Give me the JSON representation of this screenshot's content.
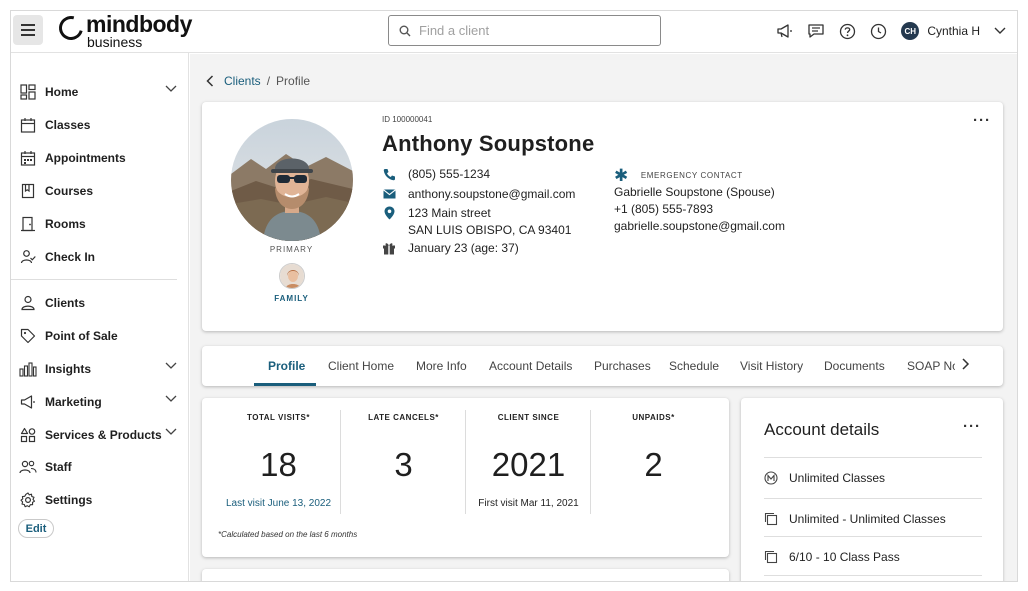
{
  "brand": {
    "name": "mindbody",
    "sub": "business"
  },
  "search": {
    "placeholder": "Find a client"
  },
  "user": {
    "initials": "CH",
    "name": "Cynthia H"
  },
  "sidebar": {
    "items": [
      {
        "label": "Home",
        "icon": "home-grid-icon"
      },
      {
        "label": "Classes",
        "icon": "calendar-icon"
      },
      {
        "label": "Appointments",
        "icon": "calendar-grid-icon"
      },
      {
        "label": "Courses",
        "icon": "bookmark-icon"
      },
      {
        "label": "Rooms",
        "icon": "door-icon"
      },
      {
        "label": "Check In",
        "icon": "person-check-icon"
      },
      {
        "label": "Clients",
        "icon": "person-icon"
      },
      {
        "label": "Point of Sale",
        "icon": "tag-icon"
      },
      {
        "label": "Insights",
        "icon": "bar-chart-icon"
      },
      {
        "label": "Marketing",
        "icon": "megaphone-icon"
      },
      {
        "label": "Services & Products",
        "icon": "shapes-icon"
      },
      {
        "label": "Staff",
        "icon": "people-icon"
      },
      {
        "label": "Settings",
        "icon": "gear-icon"
      }
    ],
    "edit_label": "Edit"
  },
  "breadcrumb": {
    "parent": "Clients",
    "separator": "/",
    "current": "Profile"
  },
  "profile": {
    "id": "ID 100000041",
    "name": "Anthony Soupstone",
    "phone": "(805) 555-1234",
    "email": "anthony.soupstone@gmail.com",
    "address_line1": "123 Main street",
    "address_line2": "SAN LUIS OBISPO, CA 93401",
    "birthday": "January 23 (age: 37)",
    "primary_label": "PRIMARY",
    "family_label": "FAMILY",
    "emergency": {
      "heading": "EMERGENCY CONTACT",
      "name": "Gabrielle Soupstone (Spouse)",
      "phone": "+1 (805) 555-7893",
      "email": "gabrielle.soupstone@gmail.com"
    }
  },
  "tabs": [
    "Profile",
    "Client Home",
    "More Info",
    "Account Details",
    "Purchases",
    "Schedule",
    "Visit History",
    "Documents",
    "SOAP No"
  ],
  "stats": [
    {
      "label": "TOTAL VISITS*",
      "value": "18",
      "sub": "Last visit June 13, 2022"
    },
    {
      "label": "LATE CANCELS*",
      "value": "3",
      "sub": ""
    },
    {
      "label": "CLIENT SINCE",
      "value": "2021",
      "sub": "First visit Mar 11, 2021"
    },
    {
      "label": "UNPAIDS*",
      "value": "2",
      "sub": ""
    }
  ],
  "stats_note": "*Calculated based on the last 6 months",
  "account": {
    "title": "Account details",
    "items": [
      {
        "label": "Unlimited Classes",
        "icon": "membership-m-icon"
      },
      {
        "label": "Unlimited - Unlimited Classes",
        "icon": "copy-icon"
      },
      {
        "label": "6/10 - 10 Class Pass",
        "icon": "copy-icon"
      }
    ]
  },
  "colors": {
    "accent": "#1a5e7c",
    "avatar_bg": "#24394f"
  }
}
